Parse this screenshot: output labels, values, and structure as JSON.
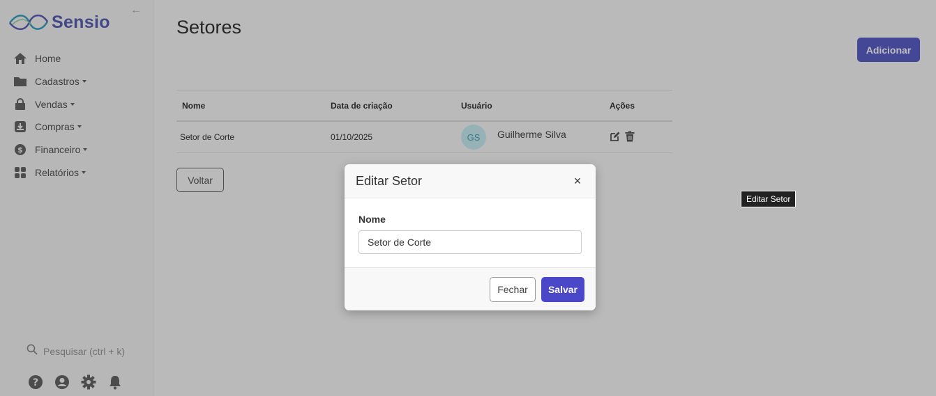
{
  "app": {
    "brand": "Sensio"
  },
  "sidebar": {
    "items": [
      {
        "label": "Home",
        "icon": "home-icon",
        "dropdown": false
      },
      {
        "label": "Cadastros",
        "icon": "folder-icon",
        "dropdown": true
      },
      {
        "label": "Vendas",
        "icon": "shopping-bag-icon",
        "dropdown": true
      },
      {
        "label": "Compras",
        "icon": "download-box-icon",
        "dropdown": true
      },
      {
        "label": "Financeiro",
        "icon": "dollar-circle-icon",
        "dropdown": true
      },
      {
        "label": "Relatórios",
        "icon": "grid-icon",
        "dropdown": true
      }
    ],
    "search_placeholder": "Pesquisar (ctrl + k)"
  },
  "page": {
    "title": "Setores",
    "add_label": "Adicionar",
    "back_label": "Voltar"
  },
  "table": {
    "headers": [
      "Nome",
      "Data de criação",
      "Usuário",
      "Ações"
    ],
    "rows": [
      {
        "nome": "Setor de Corte",
        "data": "01/10/2025",
        "initials": "GS",
        "usuario": "Guilherme Silva"
      }
    ]
  },
  "tooltip": {
    "text": "Editar Setor"
  },
  "modal": {
    "title": "Editar Setor",
    "close_label": "×",
    "field_label": "Nome",
    "field_value": "Setor de Corte",
    "cancel_label": "Fechar",
    "save_label": "Salvar"
  },
  "colors": {
    "accent": "#5b5fc7",
    "save": "#4a47c9",
    "avatar_bg": "#c9eef5"
  }
}
